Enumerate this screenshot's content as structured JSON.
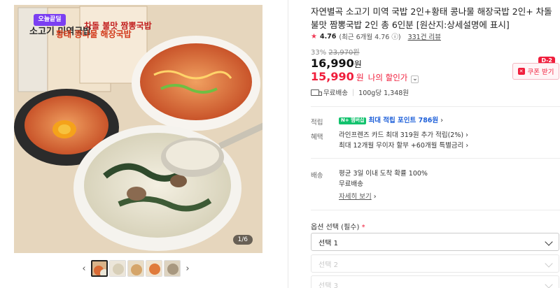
{
  "gallery": {
    "badge": "오늘끝딜",
    "page_indicator": "1/6",
    "package_labels": [
      "소고기 미역국밥",
      "황태 콩나물 해장국밥",
      "차돌 불맛 짬뽕국밥"
    ],
    "thumbnails": 5,
    "prev_arrow": "‹",
    "next_arrow": "›"
  },
  "product": {
    "title": "자연별곡 소고기 미역 국밥 2인+황태 콩나물 해장국밥 2인+ 차돌 불맛 짬뽕국밥 2인 총 6인분 [원산지:상세설명에 표시]",
    "rating_score": "4.76",
    "rating_recent": "(최근 6개월 4.76",
    "reviews": "331건 리뷰"
  },
  "price": {
    "discount_pct": "33%",
    "original": "23,970원",
    "current": "16,990",
    "current_unit": "원",
    "my_sale": "15,990",
    "my_sale_unit": "원",
    "my_sale_label": "나의 할인가",
    "coupon_label": "쿠폰 받기",
    "coupon_dday": "D-2"
  },
  "shipping_summary": {
    "free": "무료배송",
    "weight": "100g당 1,348원"
  },
  "benefits": {
    "points_label": "적립",
    "npay_badge": "N+ 멤버십",
    "points_text": "최대 적립 포인트 786원",
    "benefit_label": "혜택",
    "benefit_line1": "라인프렌즈 카드 최대 319원 추가 적립(2%)",
    "benefit_line2": "최대 12개월 무이자 할부 +60개월 특별금리"
  },
  "delivery": {
    "label": "배송",
    "line1": "평균 3일 이내 도착 확률 100%",
    "line2": "무료배송",
    "more": "자세히 보기"
  },
  "options": {
    "title": "옵션 선택 (필수)",
    "required_mark": "*",
    "select1": "선택 1",
    "select2": "선택 2",
    "select3": "선택 3"
  },
  "colors": {
    "accent_red": "#f01e3c",
    "badge_purple": "#7b3ff2",
    "npay_green": "#12c26d",
    "link_blue": "#1d5fd9"
  }
}
